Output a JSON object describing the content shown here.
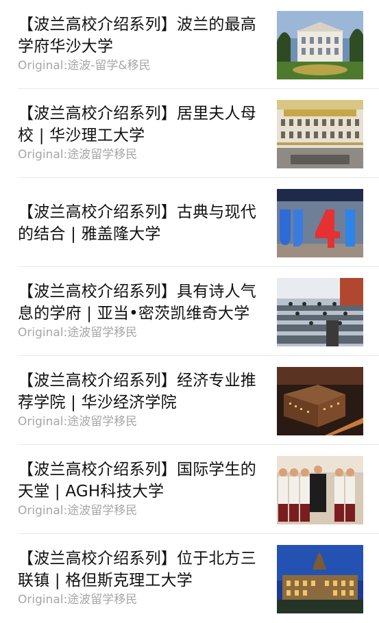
{
  "articles": [
    {
      "title": "【波兰高校介绍系列】波兰的最高学府华沙大学",
      "source": "Original:途波-留学&移民",
      "image": "university-of-warsaw-building-thumbnail"
    },
    {
      "title": "【波兰高校介绍系列】居里夫人母校 | 华沙理工大学",
      "source": "Original:途波留学移民",
      "image": "warsaw-tech-atrium-thumbnail"
    },
    {
      "title": "【波兰高校介绍系列】古典与现代的结合 | 雅盖隆大学",
      "source": "",
      "image": "jagiellonian-uj-sign-thumbnail"
    },
    {
      "title": "【波兰高校介绍系列】具有诗人气息的学府 | 亚当•密茨凯维奇大学",
      "source": "Original:途波留学移民",
      "image": "lecture-hall-thumbnail"
    },
    {
      "title": "【波兰高校介绍系列】经济专业推荐学院 | 华沙经济学院",
      "source": "Original:途波留学移民",
      "image": "night-campus-aerial-thumbnail"
    },
    {
      "title": "【波兰高校介绍系列】国际学生的天堂 | AGH科技大学",
      "source": "Original:途波留学移民",
      "image": "students-group-photo-thumbnail"
    },
    {
      "title": "【波兰高校介绍系列】位于北方三联镇 | 格但斯克理工大学",
      "source": "Original:途波留学移民",
      "image": "gdansk-tech-night-building-thumbnail"
    }
  ]
}
